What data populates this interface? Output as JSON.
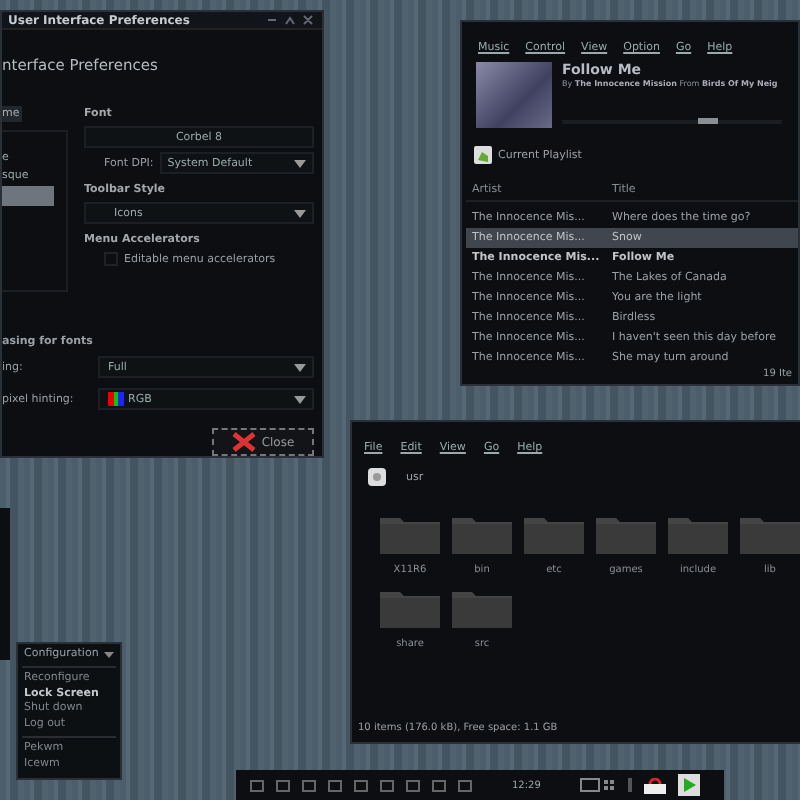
{
  "prefs_window": {
    "title": "User Interface Preferences",
    "heading": "nterface Preferences",
    "tab": "me",
    "theme_list": [
      {
        "label": "e",
        "selected": false
      },
      {
        "label": "sque",
        "selected": false
      },
      {
        "selected": true
      }
    ],
    "font_section": "Font",
    "font_button": "Corbel 8",
    "dpi_label": "Font DPI:",
    "dpi_value": "System Default",
    "toolbar_section": "Toolbar Style",
    "toolbar_value": "Icons",
    "accel_section": "Menu Accelerators",
    "accel_checkbox": {
      "label": "Editable menu accelerators",
      "checked": false
    },
    "antialias_label": "asing for fonts",
    "hinting_label": "ing:",
    "hinting_value": "Full",
    "subpixel_label": "pixel hinting:",
    "subpixel_value": "RGB",
    "close_button": "Close"
  },
  "music_window": {
    "menu": [
      "Music",
      "Control",
      "View",
      "Option",
      "Go",
      "Help"
    ],
    "track_title": "Follow Me",
    "track_info": "By **The Innocence Mission** From **Birds Of My Neig**",
    "progress": {
      "level": 0.62
    },
    "playlist_label": "Current Playlist",
    "columns": [
      "Artist",
      "Title"
    ],
    "rows": [
      {
        "artist": "The Innocence Mis...",
        "title": "Where does the time go?",
        "selected": false,
        "playing": false
      },
      {
        "artist": "The Innocence Mis...",
        "title": "Snow",
        "selected": true,
        "playing": false
      },
      {
        "artist": "The Innocence Mis...",
        "title": "Follow Me",
        "selected": false,
        "playing": true
      },
      {
        "artist": "The Innocence Mis...",
        "title": "The Lakes of Canada",
        "selected": false,
        "playing": false
      },
      {
        "artist": "The Innocence Mis...",
        "title": "You are the light",
        "selected": false,
        "playing": false
      },
      {
        "artist": "The Innocence Mis...",
        "title": "Birdless",
        "selected": false,
        "playing": false
      },
      {
        "artist": "The Innocence Mis...",
        "title": "I haven't seen this day before",
        "selected": false,
        "playing": false
      },
      {
        "artist": "The Innocence Mis...",
        "title": "She may turn around",
        "selected": false,
        "playing": false
      }
    ],
    "status": "19 Ite"
  },
  "file_window": {
    "menu": [
      "File",
      "Edit",
      "View",
      "Go",
      "Help"
    ],
    "path": "usr",
    "folders": [
      "X11R6",
      "bin",
      "etc",
      "games",
      "include",
      "lib",
      "share",
      "src"
    ],
    "status": "10 items (176.0 kB), Free space: 1.1 GB"
  },
  "context_menu": {
    "header": "Configuration",
    "groups": [
      [
        {
          "label": "Reconfigure",
          "selected": false
        },
        {
          "label": "Lock Screen",
          "selected": true
        },
        {
          "label": "Shut down",
          "selected": false
        },
        {
          "label": "Log out",
          "selected": false
        }
      ],
      [
        {
          "label": "Pekwm",
          "selected": false
        },
        {
          "label": "Icewm",
          "selected": false
        }
      ]
    ]
  },
  "taskbar": {
    "clock": "12:29"
  }
}
